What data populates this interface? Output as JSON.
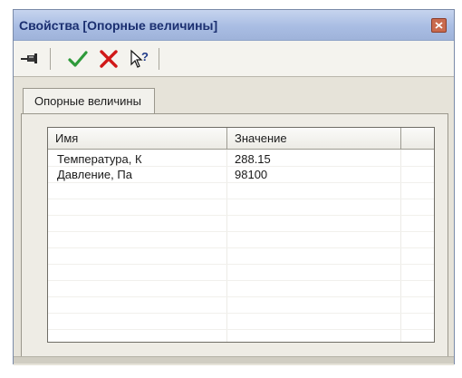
{
  "window": {
    "title": "Свойства [Опорные величины]"
  },
  "tab": {
    "label": "Опорные величины"
  },
  "table": {
    "columns": [
      "Имя",
      "Значение"
    ],
    "rows": [
      {
        "name": "Температура, К",
        "value": "288.15"
      },
      {
        "name": "Давление, Па",
        "value": "98100"
      }
    ]
  },
  "icons": {
    "pin": "pin-icon",
    "apply": "checkmark-icon",
    "cancel": "cross-icon",
    "help": "help-icon"
  },
  "colors": {
    "title_text": "#1b2f70",
    "apply": "#2e9a3a",
    "cancel": "#d01818",
    "help": "#1e3a8a"
  }
}
